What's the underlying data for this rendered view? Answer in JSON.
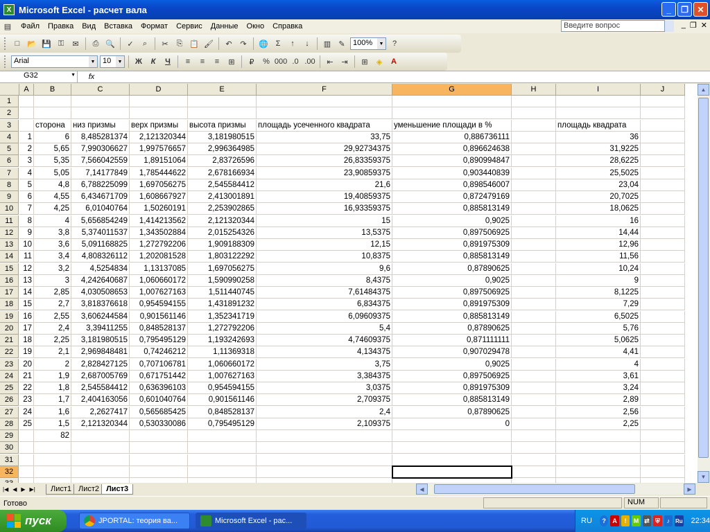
{
  "window": {
    "title": "Microsoft Excel - расчет вала",
    "icon": "excel-icon",
    "buttons": [
      "minimize",
      "restore",
      "close"
    ]
  },
  "menu": {
    "items": [
      "Файл",
      "Правка",
      "Вид",
      "Вставка",
      "Формат",
      "Сервис",
      "Данные",
      "Окно",
      "Справка"
    ],
    "ask_placeholder": "Введите вопрос"
  },
  "toolbar": {
    "zoom": "100%",
    "font_name": "Arial",
    "font_size": "10",
    "bold": "Ж",
    "italic": "К",
    "underline": "Ч"
  },
  "formula_bar": {
    "name_box": "G32",
    "fx": "fx",
    "content": ""
  },
  "sheet": {
    "columns": [
      "A",
      "B",
      "C",
      "D",
      "E",
      "F",
      "G",
      "H",
      "I",
      "J"
    ],
    "selected_column": "G",
    "selected_row": "32",
    "header_row": {
      "B": "сторона",
      "C": "низ призмы",
      "D": "верх призмы",
      "E": "высота призмы",
      "F": "площадь усеченного квадрата",
      "G": "уменьшение площади в %",
      "I": "площадь квадрата"
    },
    "rows": [
      [
        "1",
        "6",
        "8,485281374",
        "2,121320344",
        "3,181980515",
        "33,75",
        "0,886736111",
        "",
        "36"
      ],
      [
        "2",
        "5,65",
        "7,990306627",
        "1,997576657",
        "2,996364985",
        "29,92734375",
        "0,896624638",
        "",
        "31,9225"
      ],
      [
        "3",
        "5,35",
        "7,566042559",
        "1,89151064",
        "2,83726596",
        "26,83359375",
        "0,890994847",
        "",
        "28,6225"
      ],
      [
        "4",
        "5,05",
        "7,14177849",
        "1,785444622",
        "2,678166934",
        "23,90859375",
        "0,903440839",
        "",
        "25,5025"
      ],
      [
        "5",
        "4,8",
        "6,788225099",
        "1,697056275",
        "2,545584412",
        "21,6",
        "0,898546007",
        "",
        "23,04"
      ],
      [
        "6",
        "4,55",
        "6,434671709",
        "1,608667927",
        "2,413001891",
        "19,40859375",
        "0,872479169",
        "",
        "20,7025"
      ],
      [
        "7",
        "4,25",
        "6,01040764",
        "1,50260191",
        "2,253902865",
        "16,93359375",
        "0,885813149",
        "",
        "18,0625"
      ],
      [
        "8",
        "4",
        "5,656854249",
        "1,414213562",
        "2,121320344",
        "15",
        "0,9025",
        "",
        "16"
      ],
      [
        "9",
        "3,8",
        "5,374011537",
        "1,343502884",
        "2,015254326",
        "13,5375",
        "0,897506925",
        "",
        "14,44"
      ],
      [
        "10",
        "3,6",
        "5,091168825",
        "1,272792206",
        "1,909188309",
        "12,15",
        "0,891975309",
        "",
        "12,96"
      ],
      [
        "11",
        "3,4",
        "4,808326112",
        "1,202081528",
        "1,803122292",
        "10,8375",
        "0,885813149",
        "",
        "11,56"
      ],
      [
        "12",
        "3,2",
        "4,5254834",
        "1,13137085",
        "1,697056275",
        "9,6",
        "0,87890625",
        "",
        "10,24"
      ],
      [
        "13",
        "3",
        "4,242640687",
        "1,060660172",
        "1,590990258",
        "8,4375",
        "0,9025",
        "",
        "9"
      ],
      [
        "14",
        "2,85",
        "4,030508653",
        "1,007627163",
        "1,511440745",
        "7,61484375",
        "0,897506925",
        "",
        "8,1225"
      ],
      [
        "15",
        "2,7",
        "3,818376618",
        "0,954594155",
        "1,431891232",
        "6,834375",
        "0,891975309",
        "",
        "7,29"
      ],
      [
        "16",
        "2,55",
        "3,606244584",
        "0,901561146",
        "1,352341719",
        "6,09609375",
        "0,885813149",
        "",
        "6,5025"
      ],
      [
        "17",
        "2,4",
        "3,39411255",
        "0,848528137",
        "1,272792206",
        "5,4",
        "0,87890625",
        "",
        "5,76"
      ],
      [
        "18",
        "2,25",
        "3,181980515",
        "0,795495129",
        "1,193242693",
        "4,74609375",
        "0,871111111",
        "",
        "5,0625"
      ],
      [
        "19",
        "2,1",
        "2,969848481",
        "0,74246212",
        "1,11369318",
        "4,134375",
        "0,907029478",
        "",
        "4,41"
      ],
      [
        "20",
        "2",
        "2,828427125",
        "0,707106781",
        "1,060660172",
        "3,75",
        "0,9025",
        "",
        "4"
      ],
      [
        "21",
        "1,9",
        "2,687005769",
        "0,671751442",
        "1,007627163",
        "3,384375",
        "0,897506925",
        "",
        "3,61"
      ],
      [
        "22",
        "1,8",
        "2,545584412",
        "0,636396103",
        "0,954594155",
        "3,0375",
        "0,891975309",
        "",
        "3,24"
      ],
      [
        "23",
        "1,7",
        "2,404163056",
        "0,601040764",
        "0,901561146",
        "2,709375",
        "0,885813149",
        "",
        "2,89"
      ],
      [
        "24",
        "1,6",
        "2,2627417",
        "0,565685425",
        "0,848528137",
        "2,4",
        "0,87890625",
        "",
        "2,56"
      ],
      [
        "25",
        "1,5",
        "2,121320344",
        "0,530330086",
        "0,795495129",
        "2,109375",
        "0",
        "",
        "2,25"
      ]
    ],
    "total_row": {
      "B": "82"
    },
    "row_numbers": [
      "1",
      "2",
      "3",
      "4",
      "5",
      "6",
      "7",
      "8",
      "9",
      "10",
      "11",
      "12",
      "13",
      "14",
      "15",
      "16",
      "17",
      "18",
      "19",
      "20",
      "21",
      "22",
      "23",
      "24",
      "25",
      "26",
      "27",
      "28",
      "29",
      "30",
      "31",
      "32",
      "33"
    ]
  },
  "sheet_tabs": [
    "Лист1",
    "Лист2",
    "Лист3"
  ],
  "active_tab": "Лист3",
  "status": {
    "left": "Готово",
    "num": "NUM"
  },
  "taskbar": {
    "start": "пуск",
    "tasks": [
      "JPORTAL: теория ва...",
      "Microsoft Excel - рас..."
    ],
    "lang": "RU",
    "lang2": "Ru",
    "clock": "22:34"
  },
  "colors": {
    "selected_header": "#f8b560",
    "title_blue": "#0a46c8",
    "start_green": "#3d9c2e"
  }
}
